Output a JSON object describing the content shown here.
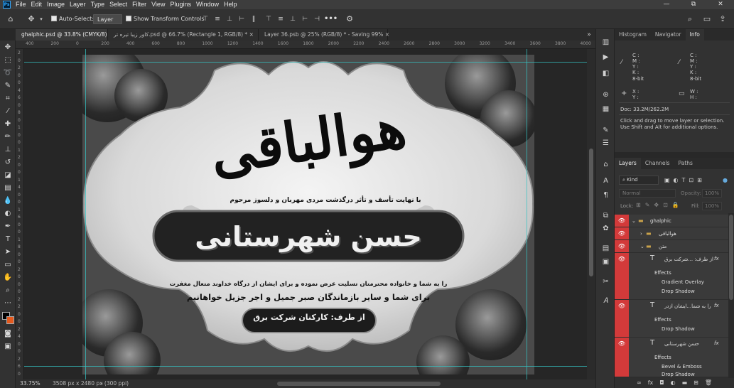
{
  "menubar": {
    "app_logo": "Ps",
    "items": [
      "File",
      "Edit",
      "Image",
      "Layer",
      "Type",
      "Select",
      "Filter",
      "View",
      "Plugins",
      "Window",
      "Help"
    ],
    "window_controls": [
      "—",
      "⧉",
      "✕"
    ]
  },
  "options": {
    "auto_select_label": "Auto-Select:",
    "auto_select_value": "Layer",
    "show_transform_label": "Show Transform Controls",
    "more": "•••"
  },
  "tabs": [
    {
      "label": "ghalphic.psd @ 33.8% (CMYK/8) *",
      "active": true
    },
    {
      "label": "کاور زیبا تیره تر.psd @ 66.7% (Rectangle 1, RGB/8) *",
      "active": false
    },
    {
      "label": "Layer 36.psb @ 25% (RGB/8) * - Saving 99%",
      "active": false
    }
  ],
  "ruler_top": [
    "400",
    "200",
    "0",
    "200",
    "400",
    "600",
    "800",
    "1000",
    "1200",
    "1400",
    "1600",
    "1800",
    "2000",
    "2200",
    "2400",
    "2600",
    "2800",
    "3000",
    "3200",
    "3400",
    "3600",
    "3800",
    "4000"
  ],
  "ruler_left": [
    "2",
    "0",
    "2",
    "0",
    "0",
    "4",
    "6",
    "0",
    "8",
    "0",
    "1",
    "0",
    "0",
    "1",
    "2",
    "0",
    "0",
    "1",
    "4",
    "0",
    "0",
    "1",
    "6",
    "0",
    "0",
    "1",
    "8",
    "0",
    "0",
    "2",
    "0",
    "0",
    "0",
    "2",
    "2",
    "0",
    "0",
    "2",
    "4",
    "0",
    "0",
    "2",
    "6",
    "0"
  ],
  "artwork": {
    "calligraphy": "هوالباقی",
    "intro": "با نهایت تأسف و تأثر درگذشت مردی مهربان و دلسوز مرحوم",
    "name": "حسن شهرستانی",
    "condolence": "را به شما و خانواده محترمتان تسلیت عرض نموده و برای ایشان از درگاه خداوند متعال مغفرت",
    "prayer": "برای شما و سایر بازماندگان صبر جمیل و اجر جزیل خواهانیم",
    "from": "از طرف: کارکنان شرکت برق"
  },
  "status": {
    "zoom": "33.75%",
    "doc_size": "3508 px x 2480 px (300 ppi)"
  },
  "info_panel": {
    "tabs": [
      "Histogram",
      "Navigator",
      "Info"
    ],
    "active_tab": "Info",
    "cmyk_labels": [
      "C :",
      "M :",
      "Y :",
      "K :"
    ],
    "bitdepth": "8-bit",
    "xy_labels": [
      "X :",
      "Y :"
    ],
    "wh_labels": [
      "W :",
      "H :"
    ],
    "doc": "Doc: 33.2M/262.2M",
    "hint": "Click and drag to move layer or selection. Use Shift and Alt for additional options."
  },
  "layers_panel": {
    "tabs": [
      "Layers",
      "Channels",
      "Paths"
    ],
    "active_tab": "Layers",
    "filter_kind": "Kind",
    "blend_mode": "Normal",
    "opacity_label": "Opacity:",
    "opacity_value": "100%",
    "lock_label": "Lock:",
    "fill_label": "Fill:",
    "fill_value": "100%",
    "groups": {
      "root": "ghalphic",
      "sub1": "هوالباقی",
      "sub2": "متن"
    },
    "layers": [
      {
        "name": "از طرف: ...شرکت برق",
        "effects_label": "Effects",
        "effects": [
          "Gradient Overlay",
          "Drop Shadow"
        ]
      },
      {
        "name": "را به شما...ایشان ازدر",
        "effects_label": "Effects",
        "effects": [
          "Drop Shadow"
        ]
      },
      {
        "name": "حسن شهرستانی",
        "effects_label": "Effects",
        "effects": [
          "Bevel & Emboss",
          "Drop Shadow"
        ]
      }
    ],
    "footer_icons": [
      "link-icon",
      "fx-icon",
      "mask-icon",
      "adjustment-icon",
      "group-icon",
      "new-layer-icon",
      "trash-icon"
    ]
  }
}
